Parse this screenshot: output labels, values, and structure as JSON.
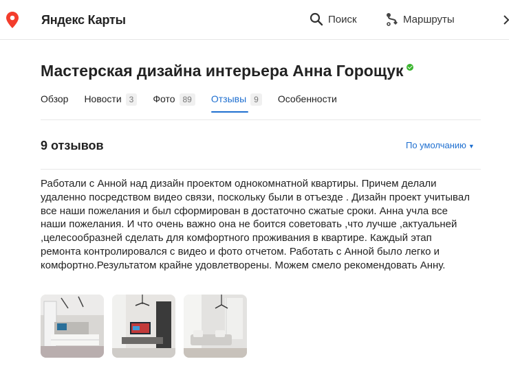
{
  "header": {
    "brand": "Яндекс Карты",
    "search_label": "Поиск",
    "routes_label": "Маршруты"
  },
  "organization": {
    "title": "Мастерская дизайна интерьера Анна Горощук",
    "verified": true
  },
  "tabs": [
    {
      "label": "Обзор",
      "badge": ""
    },
    {
      "label": "Новости",
      "badge": "3"
    },
    {
      "label": "Фото",
      "badge": "89"
    },
    {
      "label": "Отзывы",
      "badge": "9",
      "active": true
    },
    {
      "label": "Особенности",
      "badge": ""
    }
  ],
  "reviews": {
    "count_label": "9 отзывов",
    "sort_label": "По умолчанию",
    "items": [
      {
        "text": "Работали с Анной над дизайн проектом однокомнатной квартиры. Причем делали удаленно посредством видео связи, поскольку были в отъезде . Дизайн проект учитывал все наши пожелания и был сформирован в достаточно сжатые сроки. Анна учла все наши пожелания. И что очень важно она не боится советовать ,что лучше ,актуальней ,целесообразней сделать для комфортного проживания в квартире. Каждый этап ремонта контролировался с видео и фото отчетом. Работать с Анной было легко и комфортно.Результатом крайне удовлетворены. Можем смело рекомендовать Анну."
      }
    ]
  },
  "colors": {
    "accent": "#1e6fd0",
    "logo_red": "#f33d2c",
    "verified_green": "#3bb52f"
  }
}
